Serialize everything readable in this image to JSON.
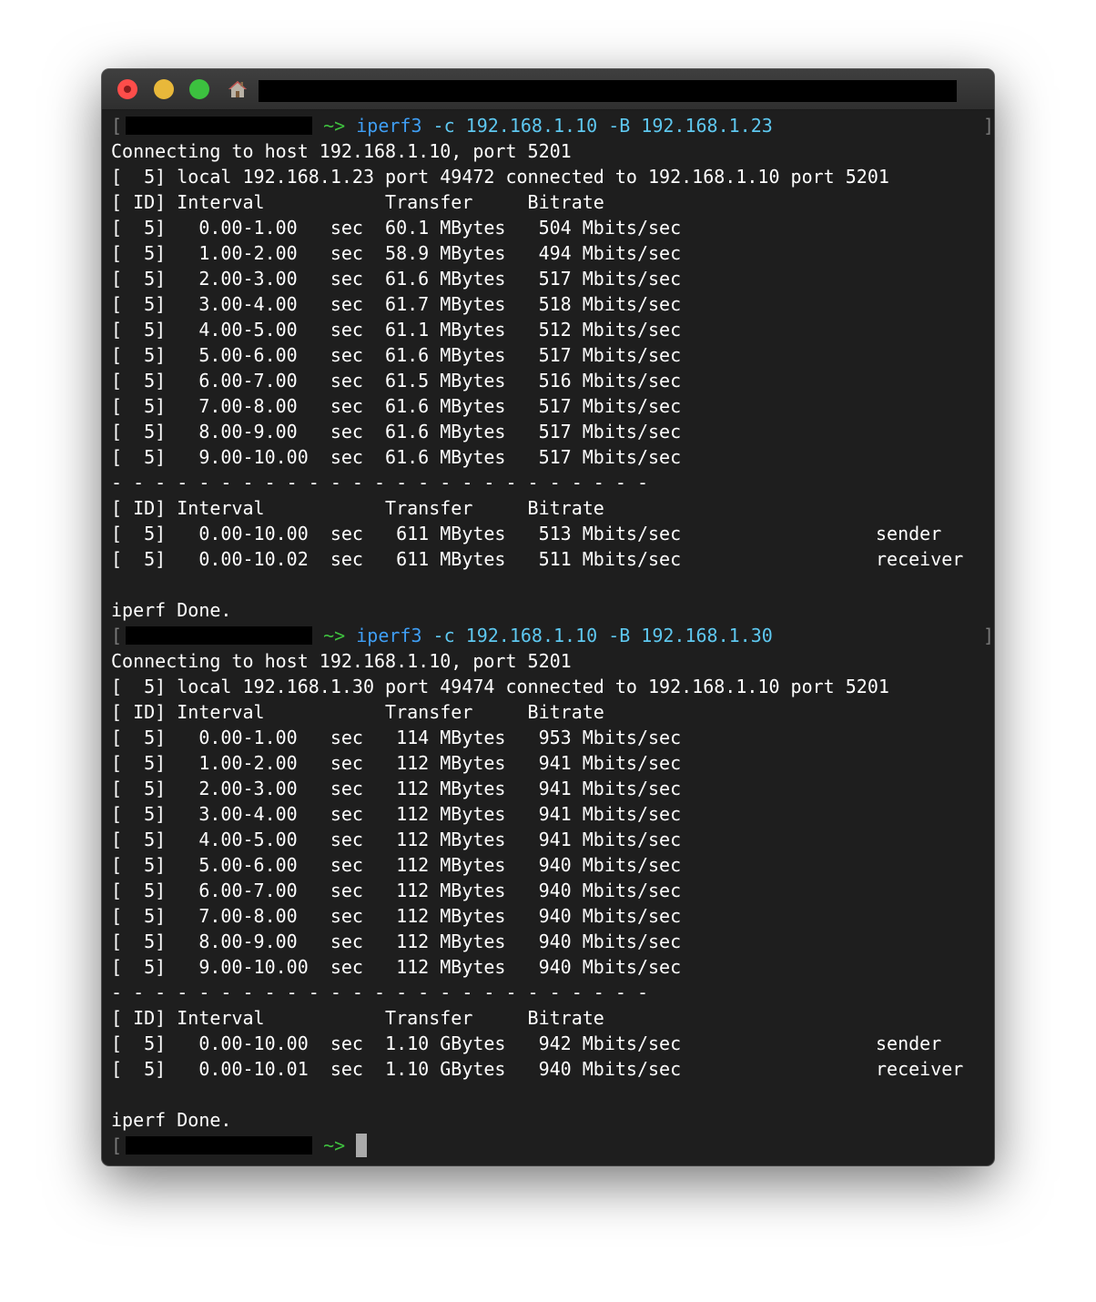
{
  "window": {
    "title_redacted": true
  },
  "prompt_arrow": "~>",
  "prompt_cursor_visible": true,
  "sessions": [
    {
      "command": "iperf3",
      "args": "-c 192.168.1.10 -B 192.168.1.23",
      "connecting": "Connecting to host 192.168.1.10, port 5201",
      "local": "[  5] local 192.168.1.23 port 49472 connected to 192.168.1.10 port 5201",
      "header": "[ ID] Interval           Transfer     Bitrate",
      "intervals": [
        "[  5]   0.00-1.00   sec  60.1 MBytes   504 Mbits/sec",
        "[  5]   1.00-2.00   sec  58.9 MBytes   494 Mbits/sec",
        "[  5]   2.00-3.00   sec  61.6 MBytes   517 Mbits/sec",
        "[  5]   3.00-4.00   sec  61.7 MBytes   518 Mbits/sec",
        "[  5]   4.00-5.00   sec  61.1 MBytes   512 Mbits/sec",
        "[  5]   5.00-6.00   sec  61.6 MBytes   517 Mbits/sec",
        "[  5]   6.00-7.00   sec  61.5 MBytes   516 Mbits/sec",
        "[  5]   7.00-8.00   sec  61.6 MBytes   517 Mbits/sec",
        "[  5]   8.00-9.00   sec  61.6 MBytes   517 Mbits/sec",
        "[  5]   9.00-10.00  sec  61.6 MBytes   517 Mbits/sec"
      ],
      "separator": "- - - - - - - - - - - - - - - - - - - - - - - - -",
      "summary_header": "[ ID] Interval           Transfer     Bitrate",
      "summary": [
        {
          "line": "[  5]   0.00-10.00  sec   611 MBytes   513 Mbits/sec",
          "role": "sender"
        },
        {
          "line": "[  5]   0.00-10.02  sec   611 MBytes   511 Mbits/sec",
          "role": "receiver"
        }
      ],
      "done": "iperf Done."
    },
    {
      "command": "iperf3",
      "args": "-c 192.168.1.10 -B 192.168.1.30",
      "connecting": "Connecting to host 192.168.1.10, port 5201",
      "local": "[  5] local 192.168.1.30 port 49474 connected to 192.168.1.10 port 5201",
      "header": "[ ID] Interval           Transfer     Bitrate",
      "intervals": [
        "[  5]   0.00-1.00   sec   114 MBytes   953 Mbits/sec",
        "[  5]   1.00-2.00   sec   112 MBytes   941 Mbits/sec",
        "[  5]   2.00-3.00   sec   112 MBytes   941 Mbits/sec",
        "[  5]   3.00-4.00   sec   112 MBytes   941 Mbits/sec",
        "[  5]   4.00-5.00   sec   112 MBytes   941 Mbits/sec",
        "[  5]   5.00-6.00   sec   112 MBytes   940 Mbits/sec",
        "[  5]   6.00-7.00   sec   112 MBytes   940 Mbits/sec",
        "[  5]   7.00-8.00   sec   112 MBytes   940 Mbits/sec",
        "[  5]   8.00-9.00   sec   112 MBytes   940 Mbits/sec",
        "[  5]   9.00-10.00  sec   112 MBytes   940 Mbits/sec"
      ],
      "separator": "- - - - - - - - - - - - - - - - - - - - - - - - -",
      "summary_header": "[ ID] Interval           Transfer     Bitrate",
      "summary": [
        {
          "line": "[  5]   0.00-10.00  sec  1.10 GBytes   942 Mbits/sec",
          "role": "sender"
        },
        {
          "line": "[  5]   0.00-10.01  sec  1.10 GBytes   940 Mbits/sec",
          "role": "receiver"
        }
      ],
      "done": "iperf Done."
    }
  ]
}
